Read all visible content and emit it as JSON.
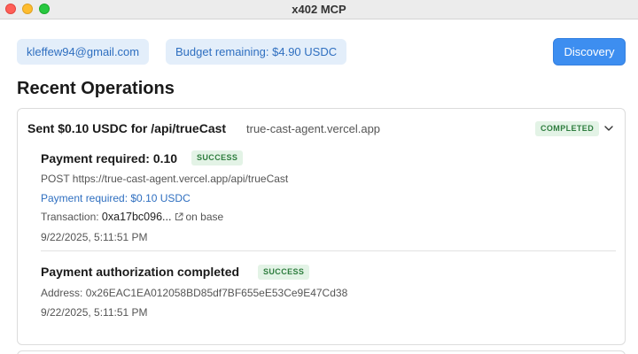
{
  "window": {
    "title": "x402 MCP"
  },
  "header": {
    "email": "kleffew94@gmail.com",
    "budget": "Budget remaining: $4.90 USDC",
    "discovery_label": "Discovery"
  },
  "section_title": "Recent Operations",
  "operation": {
    "title": "Sent $0.10 USDC for /api/trueCast",
    "host": "true-cast-agent.vercel.app",
    "status": "COMPLETED",
    "icons": {
      "expand": "chevron-down-icon",
      "external": "external-link-icon"
    },
    "steps": [
      {
        "title": "Payment required: 0.10",
        "badge": "SUCCESS",
        "request": "POST https://true-cast-agent.vercel.app/api/trueCast",
        "payment_link": "Payment required: $0.10 USDC",
        "tx_label": "Transaction: ",
        "tx_hash": "0xa17bc096...",
        "tx_network": "on base",
        "timestamp": "9/22/2025, 5:11:51 PM"
      },
      {
        "title": "Payment authorization completed",
        "badge": "SUCCESS",
        "address": "Address: 0x26EAC1EA012058BD85df7BF655eE53Ce9E47Cd38",
        "timestamp": "9/22/2025, 5:11:51 PM"
      }
    ]
  },
  "colors": {
    "accent": "#3d8ef0",
    "chip_bg": "#e3eefa",
    "chip_text": "#2f6fc0",
    "success_bg": "#e3f3e6",
    "success_text": "#2e7d3e"
  }
}
